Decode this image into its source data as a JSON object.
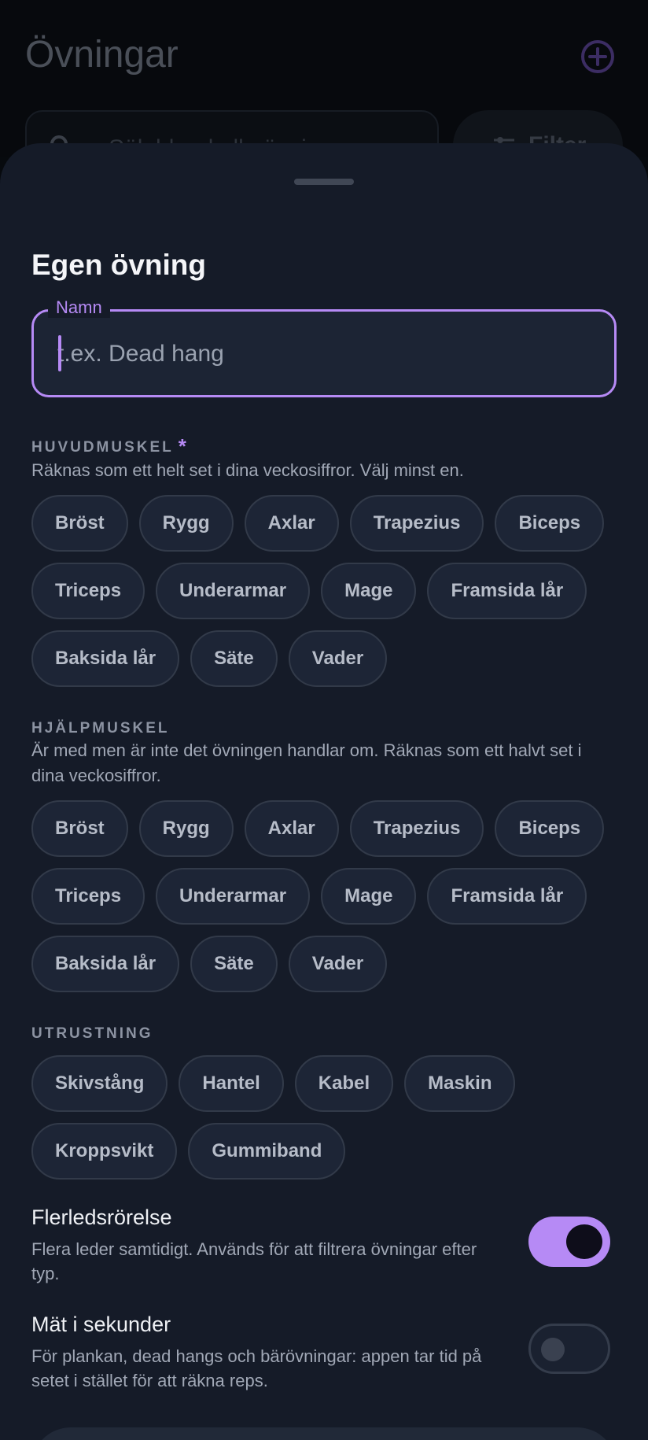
{
  "background": {
    "title": "Övningar",
    "search_placeholder": "Sök bland alla övningar",
    "filter_label": "Filter"
  },
  "sheet": {
    "title": "Egen övning",
    "name_field": {
      "label": "Namn",
      "placeholder": "t.ex. Dead hang",
      "value": ""
    },
    "primary_muscle": {
      "label": "HUVUDMUSKEL",
      "required_marker": "*",
      "description": "Räknas som ett helt set i dina veckosiffror. Välj minst en.",
      "options": [
        "Bröst",
        "Rygg",
        "Axlar",
        "Trapezius",
        "Biceps",
        "Triceps",
        "Underarmar",
        "Mage",
        "Framsida lår",
        "Baksida lår",
        "Säte",
        "Vader"
      ]
    },
    "secondary_muscle": {
      "label": "HJÄLPMUSKEL",
      "description": "Är med men är inte det övningen handlar om. Räknas som ett halvt set i dina veckosiffror.",
      "options": [
        "Bröst",
        "Rygg",
        "Axlar",
        "Trapezius",
        "Biceps",
        "Triceps",
        "Underarmar",
        "Mage",
        "Framsida lår",
        "Baksida lår",
        "Säte",
        "Vader"
      ]
    },
    "equipment": {
      "label": "UTRUSTNING",
      "options": [
        "Skivstång",
        "Hantel",
        "Kabel",
        "Maskin",
        "Kroppsvikt",
        "Gummiband"
      ]
    },
    "compound": {
      "title": "Flerledsrörelse",
      "description": "Flera leder samtidigt. Används för att filtrera övningar efter typ.",
      "enabled": true
    },
    "timed": {
      "title": "Mät i sekunder",
      "description": "För plankan, dead hangs och bärövningar: appen tar tid på setet i stället för att räkna reps.",
      "enabled": false
    }
  },
  "colors": {
    "accent": "#b68af5",
    "sheet_bg": "#151b28",
    "chip_bg": "#1d2536",
    "chip_border": "#323a49"
  }
}
